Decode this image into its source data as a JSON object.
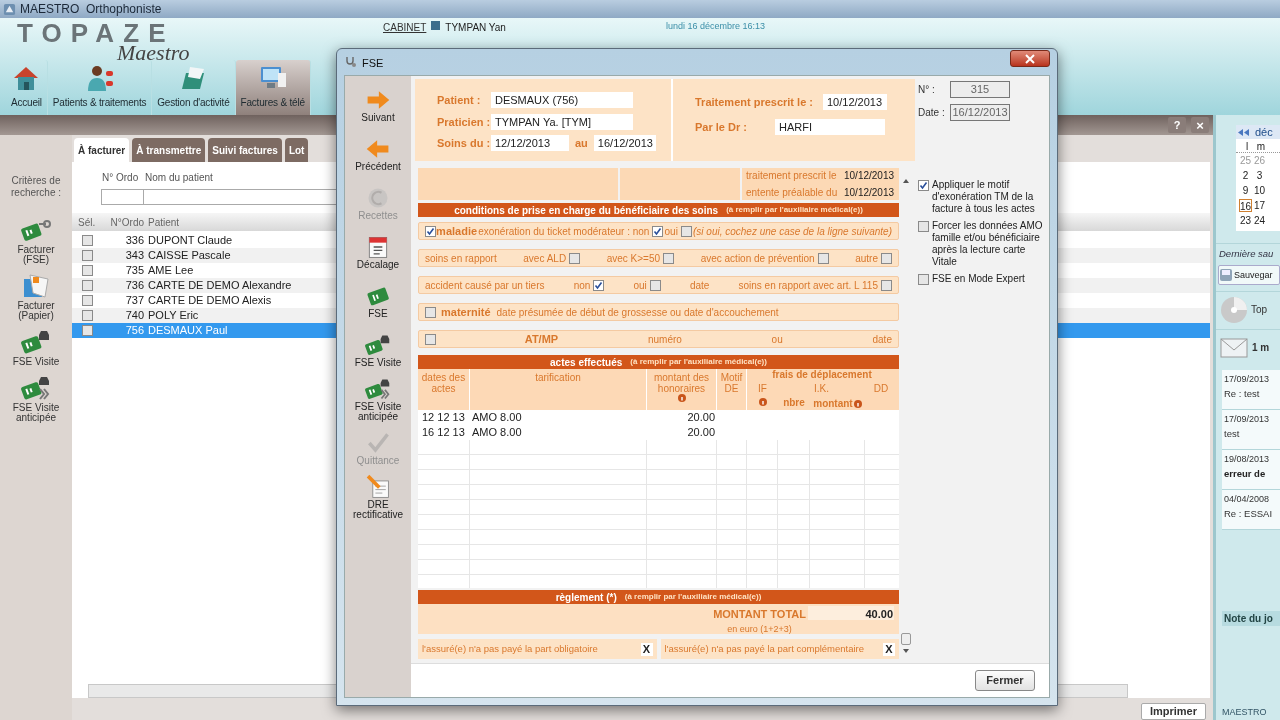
{
  "window": {
    "title": "MAESTRO  Orthophoniste"
  },
  "header": {
    "logo": {
      "title": "TOPAZE",
      "subtitle": "Maestro"
    },
    "cabinet_link": "CABINET",
    "user": "TYMPAN Yan",
    "datetime": "lundi 16 décembre 16:13",
    "nav": [
      {
        "label": "Accueil",
        "kind": "house",
        "selected": false
      },
      {
        "label": "Patients & traitements",
        "kind": "people",
        "selected": false
      },
      {
        "label": "Gestion d'activité",
        "kind": "folder",
        "selected": false
      },
      {
        "label": "Factures & télé",
        "kind": "computer",
        "selected": true
      }
    ]
  },
  "billing": {
    "tabs": [
      {
        "label": "À facturer",
        "selected": true
      },
      {
        "label": "À transmettre",
        "selected": false
      },
      {
        "label": "Suivi factures",
        "selected": false
      },
      {
        "label": "Lot",
        "selected": false
      }
    ],
    "help_button": "?",
    "close_button": "×",
    "search_label": "Critères de recherche :",
    "search_fields": [
      {
        "label": "N° Ordo"
      },
      {
        "label": "Nom du patient"
      }
    ],
    "actions": [
      {
        "label": "Facturer (FSE)",
        "kind": "card-key"
      },
      {
        "label": "Facturer (Papier)",
        "kind": "papers"
      },
      {
        "label": "FSE Visite",
        "kind": "card-car"
      },
      {
        "label": "FSE Visite anticipée",
        "kind": "card-car-ahead"
      }
    ],
    "table": {
      "columns": [
        "Sél.",
        "N°Ordo",
        "Patient"
      ],
      "rows": [
        {
          "ordo": "336",
          "patient": "DUPONT Claude",
          "checked": false,
          "selected": false
        },
        {
          "ordo": "343",
          "patient": "CAISSE Pascale",
          "checked": false,
          "selected": false
        },
        {
          "ordo": "735",
          "patient": "AME Lee",
          "checked": false,
          "selected": false
        },
        {
          "ordo": "736",
          "patient": "CARTE DE DEMO Alexandre",
          "checked": false,
          "selected": false
        },
        {
          "ordo": "737",
          "patient": "CARTE DE DEMO Alexis",
          "checked": false,
          "selected": false
        },
        {
          "ordo": "740",
          "patient": "POLY Eric",
          "checked": false,
          "selected": false
        },
        {
          "ordo": "756",
          "patient": "DESMAUX Paul",
          "checked": false,
          "selected": true
        }
      ]
    },
    "print_button": "Imprimer"
  },
  "sidebar": {
    "calendar": {
      "month": "déc",
      "weekdays": [
        "l",
        "m"
      ],
      "weeks": [
        [
          {
            "day": "25",
            "selected": false,
            "other_month": true
          },
          {
            "day": "26",
            "selected": false,
            "other_month": true
          }
        ],
        [
          {
            "day": "2",
            "selected": false,
            "other_month": false
          },
          {
            "day": "3",
            "selected": false,
            "other_month": false
          }
        ],
        [
          {
            "day": "9",
            "selected": false,
            "other_month": false
          },
          {
            "day": "10",
            "selected": false,
            "other_month": false
          }
        ],
        [
          {
            "day": "16",
            "selected": true,
            "other_month": false
          },
          {
            "day": "17",
            "selected": false,
            "other_month": false
          }
        ],
        [
          {
            "day": "23",
            "selected": false,
            "other_month": false
          },
          {
            "day": "24",
            "selected": false,
            "other_month": false
          }
        ]
      ]
    },
    "backup_label": "Dernière sau",
    "backup_button": "Sauvegar",
    "app_label": "Top",
    "mail_label": "1 m",
    "messages": [
      {
        "date": "17/09/2013",
        "subject": "Re : test",
        "unread": false
      },
      {
        "date": "17/09/2013",
        "subject": "test",
        "unread": false
      },
      {
        "date": "19/08/2013",
        "subject": "erreur de",
        "unread": true
      },
      {
        "date": "04/04/2008",
        "subject": "Re : ESSAI",
        "unread": false
      }
    ],
    "note_title": "Note du jo",
    "footer": "MAESTRO"
  },
  "dialog": {
    "title": "FSE",
    "sidebar": [
      {
        "label": "Suivant",
        "kind": "next",
        "disabled": false
      },
      {
        "label": "Précédent",
        "kind": "prev",
        "disabled": false
      },
      {
        "label": "Recettes",
        "kind": "euro",
        "disabled": true
      },
      {
        "label": "Décalage",
        "kind": "calendar",
        "disabled": false
      },
      {
        "label": "FSE",
        "kind": "card",
        "disabled": false
      },
      {
        "label": "FSE Visite",
        "kind": "card-car",
        "disabled": false
      },
      {
        "label": "FSE Visite anticipée",
        "kind": "card-car-ahead",
        "disabled": false
      },
      {
        "label": "Quittance",
        "kind": "check",
        "disabled": true
      },
      {
        "label": "DRE rectificative",
        "kind": "pencil-doc",
        "disabled": false
      }
    ],
    "patient": {
      "label": "Patient :",
      "value": "DESMAUX (756)"
    },
    "practitioner": {
      "label": "Praticien :",
      "value": "TYMPAN Ya. [TYM]"
    },
    "care_period": {
      "label": "Soins du :",
      "from": "12/12/2013",
      "to_label": "au",
      "to": "16/12/2013"
    },
    "prescribed": {
      "label": "Traitement prescrit le :",
      "value": "10/12/2013"
    },
    "doctor": {
      "label": "Par le Dr :",
      "value": "HARFI"
    },
    "number": {
      "label": "N° :",
      "value": "315"
    },
    "date": {
      "label": "Date :",
      "value": "16/12/2013"
    },
    "options": [
      {
        "label": "Appliquer le motif d'exonération TM de la facture à tous les actes",
        "checked": true
      },
      {
        "label": "Forcer les données AMO famille et/ou bénéficiaire après la lecture carte Vitale",
        "checked": false
      },
      {
        "label": "FSE en Mode Expert",
        "checked": false
      }
    ],
    "prescription": [
      {
        "label": "traitement prescrit le",
        "value": "10/12/2013"
      },
      {
        "label": "entente préalable du",
        "value": "10/12/2013"
      }
    ],
    "conditions": {
      "title": "conditions de prise en charge du bénéficiaire des soins",
      "note": "(à remplir par l'auxiliaire médical(e))",
      "rows": [
        {
          "items": [
            {
              "kind": "heading",
              "label": "maladie",
              "checked": true
            },
            {
              "kind": "check",
              "label": "exonération du ticket modérateur : non",
              "checked": true
            },
            {
              "kind": "check",
              "label": "oui",
              "checked": false
            },
            {
              "kind": "note",
              "text": "(si oui, cochez une case de la ligne suivante)"
            }
          ]
        },
        {
          "items": [
            {
              "kind": "text",
              "text": "soins en rapport"
            },
            {
              "kind": "check",
              "label": "avec ALD",
              "checked": false
            },
            {
              "kind": "check",
              "label": "avec K>=50",
              "checked": false
            },
            {
              "kind": "check",
              "label": "avec action de prévention",
              "checked": false
            },
            {
              "kind": "check",
              "label": "autre",
              "checked": false
            }
          ]
        },
        {
          "items": [
            {
              "kind": "text",
              "text": "accident causé par un tiers"
            },
            {
              "kind": "check",
              "label": "non",
              "checked": true
            },
            {
              "kind": "check",
              "label": "oui",
              "checked": false
            },
            {
              "kind": "text",
              "text": "date"
            },
            {
              "kind": "check",
              "label": "soins en rapport avec art. L 115",
              "checked": false
            }
          ]
        },
        {
          "items": [
            {
              "kind": "heading",
              "label": "maternité",
              "checked": false
            },
            {
              "kind": "text",
              "text": "date présumée de début de grossesse ou date d'accouchement"
            }
          ]
        },
        {
          "items": [
            {
              "kind": "heading",
              "label": "AT/MP",
              "checked": false
            },
            {
              "kind": "text",
              "text": "numéro"
            },
            {
              "kind": "text",
              "text": "ou"
            },
            {
              "kind": "text",
              "text": "date"
            }
          ]
        }
      ]
    },
    "acts": {
      "title": "actes effectués",
      "note": "(à remplir par l'auxiliaire médical(e))",
      "columns": [
        {
          "label": "dates des actes",
          "info": false
        },
        {
          "label": "tarification",
          "info": false
        },
        {
          "label": "montant des honoraires",
          "info": true
        },
        {
          "label": "Motif DE",
          "info": false
        }
      ],
      "travel": {
        "label": "frais de déplacement",
        "if": {
          "label": "IF",
          "info": true
        },
        "ik": {
          "label": "I.K.",
          "count": "nbre",
          "amount": "montant",
          "info": true
        },
        "dd": {
          "label": "DD",
          "info": false
        }
      },
      "rows": [
        {
          "date": "12 12 13",
          "tarification": "AMO 8.00",
          "amount": "20.00"
        },
        {
          "date": "16 12 13",
          "tarification": "AMO 8.00",
          "amount": "20.00"
        }
      ]
    },
    "payment": {
      "title": "règlement (*)",
      "note": "(à remplir par l'auxiliaire médical(e))",
      "total_label": "MONTANT TOTAL",
      "total_hint": "en euro (1+2+3)",
      "total": "40.00",
      "unpaid": [
        {
          "label": "l'assuré(e) n'a pas payé la part obligatoire",
          "mark": "X"
        },
        {
          "label": "l'assuré(e) n'a pas payé la part complémentaire",
          "mark": "X"
        }
      ]
    },
    "close_button": "Fermer"
  }
}
